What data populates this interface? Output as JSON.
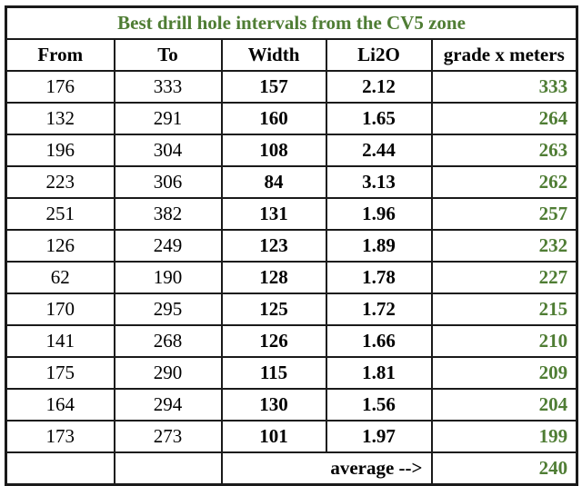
{
  "table": {
    "title": "Best drill hole intervals from the CV5 zone",
    "columns": [
      {
        "key": "from",
        "label": "From"
      },
      {
        "key": "to",
        "label": "To"
      },
      {
        "key": "width",
        "label": "Width"
      },
      {
        "key": "li2o",
        "label": "Li2O"
      },
      {
        "key": "grade",
        "label": "grade x meters"
      }
    ],
    "rows": [
      {
        "from": "176",
        "to": "333",
        "width": "157",
        "li2o": "2.12",
        "grade": "333"
      },
      {
        "from": "132",
        "to": "291",
        "width": "160",
        "li2o": "1.65",
        "grade": "264"
      },
      {
        "from": "196",
        "to": "304",
        "width": "108",
        "li2o": "2.44",
        "grade": "263"
      },
      {
        "from": "223",
        "to": "306",
        "width": "84",
        "li2o": "3.13",
        "grade": "262"
      },
      {
        "from": "251",
        "to": "382",
        "width": "131",
        "li2o": "1.96",
        "grade": "257"
      },
      {
        "from": "126",
        "to": "249",
        "width": "123",
        "li2o": "1.89",
        "grade": "232"
      },
      {
        "from": "62",
        "to": "190",
        "width": "128",
        "li2o": "1.78",
        "grade": "227"
      },
      {
        "from": "170",
        "to": "295",
        "width": "125",
        "li2o": "1.72",
        "grade": "215"
      },
      {
        "from": "141",
        "to": "268",
        "width": "126",
        "li2o": "1.66",
        "grade": "210"
      },
      {
        "from": "175",
        "to": "290",
        "width": "115",
        "li2o": "1.81",
        "grade": "209"
      },
      {
        "from": "164",
        "to": "294",
        "width": "130",
        "li2o": "1.56",
        "grade": "204"
      },
      {
        "from": "173",
        "to": "273",
        "width": "101",
        "li2o": "1.97",
        "grade": "199"
      }
    ],
    "summary": {
      "from": "",
      "to": "",
      "label": "average -->",
      "grade": "240"
    },
    "colors": {
      "accent_green": "#4F7D34",
      "border": "#1a1a1a",
      "text": "#000000",
      "background": "#ffffff"
    }
  }
}
